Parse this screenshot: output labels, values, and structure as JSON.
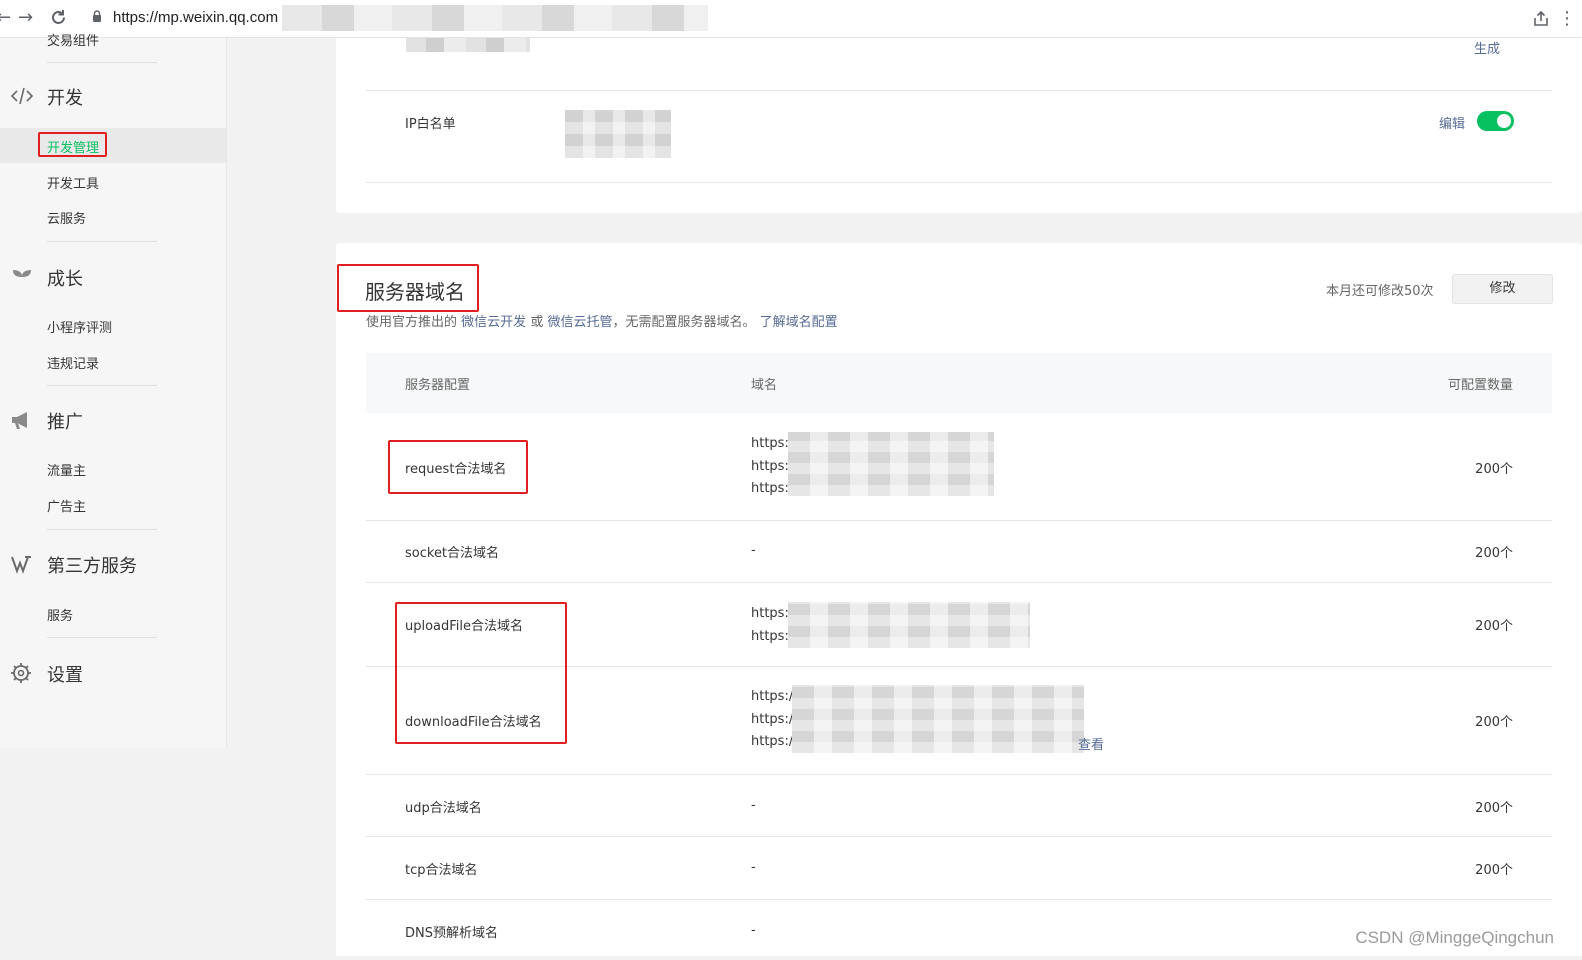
{
  "browser": {
    "url": "https://mp.weixin.qq.com",
    "icons": [
      "back-icon",
      "forward-icon",
      "reload-icon",
      "lock-icon",
      "share-icon"
    ]
  },
  "sidebar": {
    "cut_item": "交易组件",
    "sections": [
      {
        "title": "开发",
        "icon": "code-icon",
        "items": [
          "开发管理",
          "开发工具",
          "云服务"
        ]
      },
      {
        "title": "成长",
        "icon": "sprout-icon",
        "items": [
          "小程序评测",
          "违规记录"
        ]
      },
      {
        "title": "推广",
        "icon": "megaphone-icon",
        "items": [
          "流量主",
          "广告主"
        ]
      },
      {
        "title": "第三方服务",
        "icon": "third-party-icon",
        "items": [
          "服务"
        ]
      },
      {
        "title": "设置",
        "icon": "gear-icon",
        "items": []
      }
    ],
    "active_item": "开发管理",
    "active_color": "#07c160"
  },
  "card1": {
    "generate_link": "生成",
    "ip_whitelist_label": "IP白名单",
    "edit_link": "编辑",
    "toggle_on": true
  },
  "server_domain": {
    "title": "服务器域名",
    "remaining": "本月还可修改50次",
    "modify_button": "修改",
    "desc": {
      "prefix": "使用官方推出的",
      "link1": "微信云开发",
      "or": "或",
      "link2": "微信云托管",
      "middle": "，无需配置服务器域名。",
      "link3": "了解域名配置"
    },
    "columns": [
      "服务器配置",
      "域名",
      "可配置数量"
    ],
    "rows": [
      {
        "name": "request合法域名",
        "domains": [
          "https:",
          "https:",
          "https:/"
        ],
        "count": "200个"
      },
      {
        "name": "socket合法域名",
        "domains": [
          "-"
        ],
        "count": "200个"
      },
      {
        "name": "uploadFile合法域名",
        "domains": [
          "https:",
          "https:/"
        ],
        "count": "200个"
      },
      {
        "name": "downloadFile合法域名",
        "domains": [
          "https:/",
          "https:/",
          "https:/"
        ],
        "count": "200个",
        "view_more": "查看"
      },
      {
        "name": "udp合法域名",
        "domains": [
          "-"
        ],
        "count": "200个"
      },
      {
        "name": "tcp合法域名",
        "domains": [
          "-"
        ],
        "count": "200个"
      },
      {
        "name": "DNS预解析域名",
        "domains": [
          "-"
        ],
        "count": ""
      }
    ]
  },
  "watermark": "CSDN @MinggeQingchun",
  "colors": {
    "accent_green": "#07c160",
    "link_blue": "#576b95",
    "annotation_red": "#e02020"
  }
}
